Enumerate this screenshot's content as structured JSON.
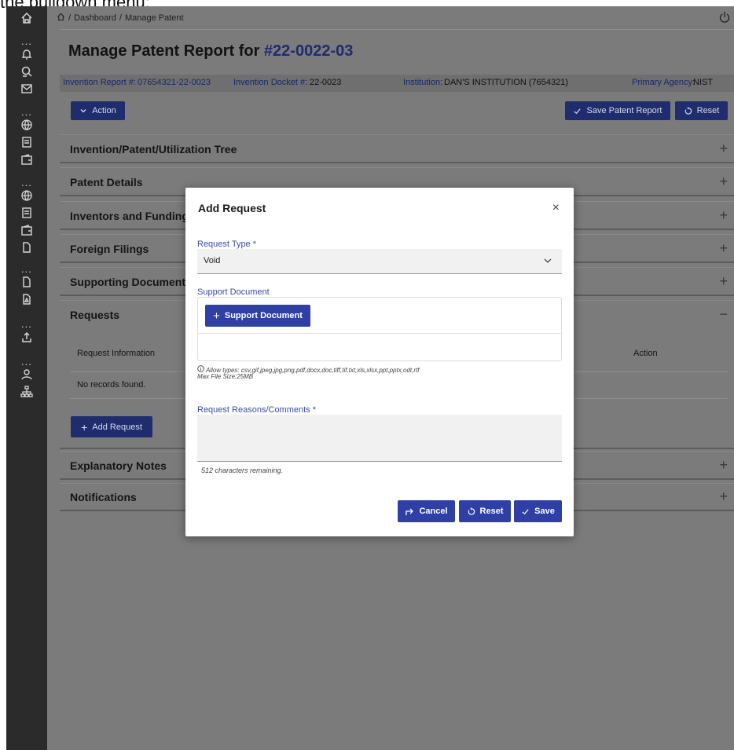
{
  "caption": "the pulldown menu:",
  "breadcrumb": {
    "dashboard": "Dashboard",
    "sep1": "/",
    "sep2": "/",
    "current": "Manage Patent"
  },
  "page": {
    "title_prefix": "Manage Patent Report for",
    "title_id": "#22-0022-03"
  },
  "info": {
    "invention_report_label": "Invention Report #:",
    "invention_report_value": "07654321-22-0023",
    "docket_label": "Invention Docket #:",
    "docket_value": "22-0023",
    "institution_label": "Institution:",
    "institution_value": "DAN'S INSTITUTION (7654321)",
    "agency_label": "Primary Agency:",
    "agency_value": "NIST"
  },
  "toolbar": {
    "action_label": "Action",
    "save_label": "Save Patent Report",
    "reset_label": "Reset"
  },
  "panels": [
    {
      "title": "Invention/Patent/Utilization Tree",
      "sign": "+"
    },
    {
      "title": "Patent Details",
      "sign": "+"
    },
    {
      "title": "Inventors and Fundings",
      "sign": "+"
    },
    {
      "title": "Foreign Filings",
      "sign": "+"
    },
    {
      "title": "Supporting Documents",
      "sign": "+"
    },
    {
      "title": "Requests",
      "sign": "−"
    },
    {
      "title": "Explanatory Notes",
      "sign": "+"
    },
    {
      "title": "Notifications",
      "sign": "+"
    }
  ],
  "requests": {
    "col_info": "Request Information",
    "col_action": "Action",
    "empty": "No records found.",
    "add_label": "Add Request"
  },
  "modal": {
    "title": "Add Request",
    "close": "×",
    "request_type_label": "Request Type *",
    "request_type_value": "Void",
    "support_doc_label": "Support Document",
    "support_doc_button": "Support Document",
    "allow_types": "Allow types: csv,gif,jpeg,jpg,png,pdf,docx,doc,tiff,tif,txt,xls,xlsx,ppt,pptx,odt,rtf",
    "max_size": "Max File Size:25MB",
    "reasons_label": "Request Reasons/Comments *",
    "remaining": "512 characters remaining.",
    "cancel_label": "Cancel",
    "reset_label": "Reset",
    "save_label": "Save"
  },
  "icons": {
    "sidebar": [
      "home-icon",
      "bell-icon",
      "search-icon",
      "mail-icon",
      "globe-icon",
      "document-icon",
      "wallet-icon",
      "globe-icon",
      "document-icon",
      "wallet-icon",
      "file-icon",
      "file-icon",
      "pdf-icon",
      "upload-icon",
      "user-icon",
      "org-chart-icon"
    ]
  },
  "colors": {
    "accent": "#2f3fa6",
    "title_accent": "#1e2b6f",
    "sidebar": "#2b2b2b"
  }
}
